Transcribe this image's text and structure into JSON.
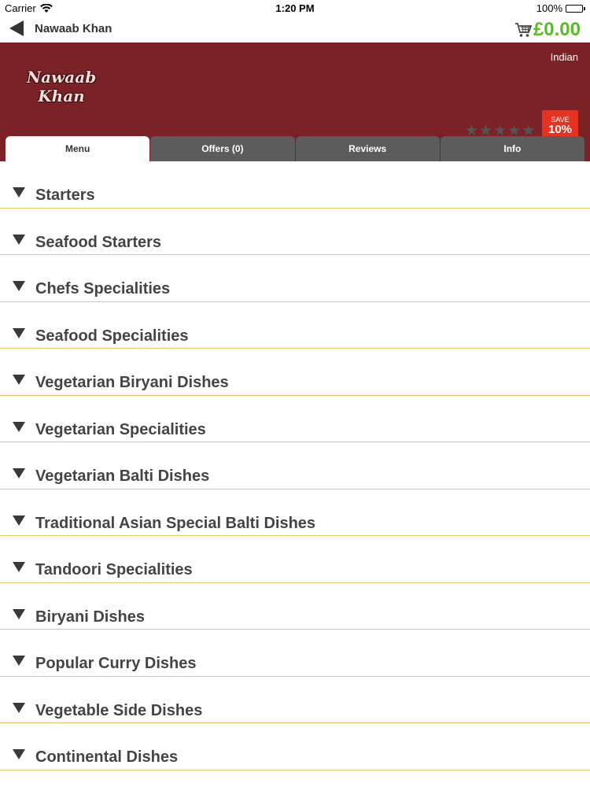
{
  "status_bar": {
    "carrier": "Carrier",
    "time": "1:20 PM",
    "battery": "100%"
  },
  "nav": {
    "title": "Nawaab Khan",
    "cart_total": "£0.00"
  },
  "restaurant": {
    "logo_line1": "Nawaab",
    "logo_line2": "Khan",
    "cuisine": "Indian",
    "rating": 0,
    "save_label": "SAVE",
    "save_value": "10%"
  },
  "tabs": [
    {
      "label": "Menu",
      "active": true
    },
    {
      "label": "Offers (0)",
      "active": false
    },
    {
      "label": "Reviews",
      "active": false
    },
    {
      "label": "Info",
      "active": false
    }
  ],
  "categories": [
    {
      "label": "Starters"
    },
    {
      "label": "Seafood Starters"
    },
    {
      "label": "Chefs Specialities"
    },
    {
      "label": "Seafood Specialities"
    },
    {
      "label": "Vegetarian Biryani Dishes"
    },
    {
      "label": "Vegetarian Specialities"
    },
    {
      "label": "Vegetarian Balti Dishes"
    },
    {
      "label": "Traditional Asian Special Balti Dishes"
    },
    {
      "label": "Tandoori Specialities"
    },
    {
      "label": "Biryani Dishes"
    },
    {
      "label": "Popular Curry Dishes"
    },
    {
      "label": "Vegetable Side Dishes"
    },
    {
      "label": "Continental Dishes"
    }
  ],
  "colors": {
    "banner": "#7b2226",
    "cart_total": "#5cb82c",
    "save_ribbon": "#e53323",
    "tab_inactive": "#5c5c5c",
    "row_divider": "#e9c36b"
  },
  "icons": {
    "back": "back-arrow-icon",
    "cart": "shopping-cart-icon",
    "expand": "triangle-down-icon",
    "star": "star-icon",
    "wifi": "wifi-icon",
    "battery": "battery-icon"
  }
}
